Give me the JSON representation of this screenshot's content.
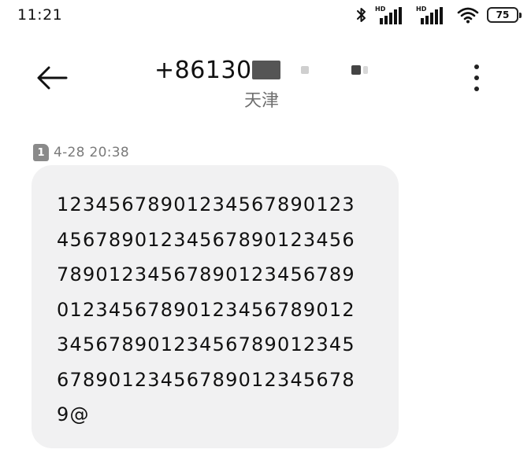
{
  "status_bar": {
    "time": "11:21",
    "signal_badge": "HD",
    "battery_level": "75",
    "icons": [
      "bluetooth-icon",
      "signal-hd-icon",
      "signal-hd-icon",
      "wifi-icon",
      "battery-icon"
    ]
  },
  "header": {
    "phone_prefix": "+8613",
    "phone_visible": "0",
    "location": "天津",
    "back_icon": "back-arrow-icon",
    "more_icon": "more-vertical-icon"
  },
  "message": {
    "sim_slot": "1",
    "timestamp": "4-28 20:38",
    "lines": [
      "12345678901234567890123",
      "45678901234567890123456",
      "78901234567890123456789",
      "01234567890123456789012",
      "34567890123456789012345",
      "67890123456789012345678",
      "9@"
    ]
  },
  "colors": {
    "bubble_bg": "#f1f1f2",
    "text": "#111111",
    "meta_text": "#7a7a7a",
    "sim_badge": "#8a8a8a"
  }
}
